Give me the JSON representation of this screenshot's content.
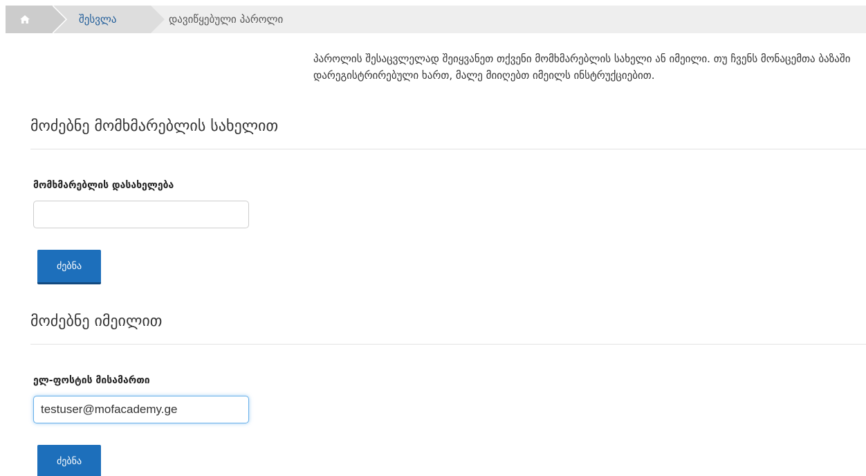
{
  "breadcrumb": {
    "home_icon": "home-icon",
    "login_label": "შესვლა",
    "current_label": "დავიწყებული პაროლი"
  },
  "intro": {
    "text": "პაროლის შესაცვლელად შეიყვანეთ თქვენი მომხმარებლის სახელი ან იმეილი. თუ ჩვენს მონაცემთა ბაზაში დარეგისტრირებული ხართ, მალე მიიღებთ იმეილს ინსტრუქციებით."
  },
  "username_section": {
    "title": "მოძებნე მომხმარებლის სახელით",
    "label": "მომხმარებლის დასახელება",
    "value": "",
    "button_label": "ძებნა"
  },
  "email_section": {
    "title": "მოძებნე იმეილით",
    "label": "ელ-ფოსტის მისამართი",
    "value": "testuser@mofacademy.ge",
    "button_label": "ძებნა"
  },
  "colors": {
    "accent": "#1d6fbb",
    "breadcrumb_bg": "#eeeeee",
    "breadcrumb_active": "#cccccc"
  }
}
